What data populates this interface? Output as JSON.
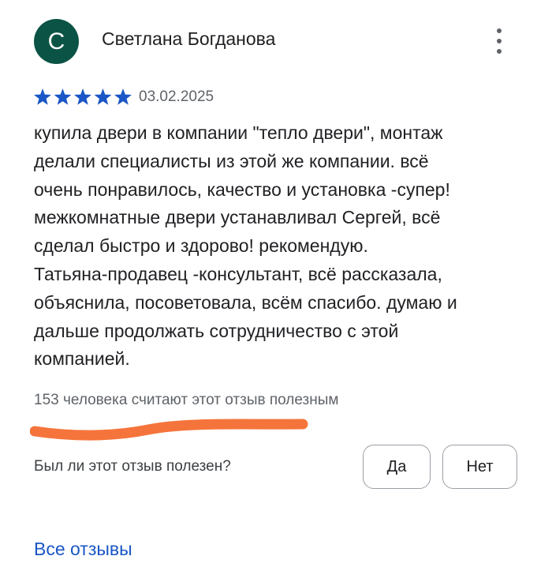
{
  "review": {
    "avatar_letter": "С",
    "avatar_color": "#0b5445",
    "author_name": "Светлана Богданова",
    "more_icon": "more-vert-icon",
    "rating": 5,
    "rating_max": 5,
    "star_color": "#1a56c5",
    "date": "03.02.2025",
    "text_lines": [
      "купила двери в компании \"тепло двери\", монтаж",
      "делали специалисты из этой же компании. всё",
      "очень понравилось, качество и установка -супер!",
      "межкомнатные двери устанавливал Сергей, всё",
      "сделал быстро и здорово! рекомендую.",
      "Татьяна-продавец -консультант, всё рассказала,",
      "объяснила, посоветовала, всём спасибо. думаю и",
      "дальше продолжать сотрудничество с этой",
      "компанией."
    ],
    "helpful_count_text": "153 человека считают этот отзыв полезным",
    "highlight_color": "#f5743b"
  },
  "feedback": {
    "question": "Был ли этот отзыв полезен?",
    "yes_label": "Да",
    "no_label": "Нет"
  },
  "footer": {
    "all_reviews_label": "Все отзывы",
    "link_color": "#1a56c5"
  }
}
